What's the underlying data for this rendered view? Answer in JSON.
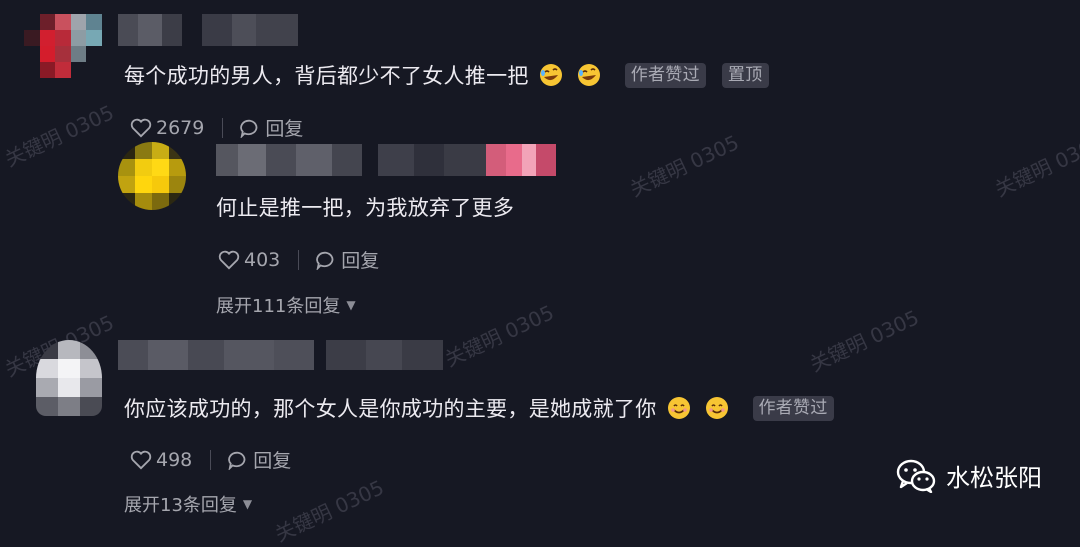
{
  "comments": [
    {
      "text": "每个成功的男人，背后都少不了女人推一把",
      "emoji": [
        "rolling-laughing-emoji",
        "rolling-laughing-emoji"
      ],
      "tags": [
        "作者赞过",
        "置顶"
      ],
      "likes": "2679",
      "reply_label": "回复"
    },
    {
      "text": "何止是推一把，为我放弃了更多",
      "likes": "403",
      "reply_label": "回复",
      "expand_label": "展开111条回复"
    },
    {
      "text": "你应该成功的，那个女人是你成功的主要，是她成就了你",
      "emoji": [
        "smiling-emoji",
        "smiling-emoji"
      ],
      "tags": [
        "作者赞过"
      ],
      "likes": "498",
      "reply_label": "回复",
      "expand_label": "展开13条回复"
    }
  ],
  "watermark": "关键明 0305",
  "brand": {
    "name": "水松张阳",
    "icon": "wechat-icon"
  }
}
